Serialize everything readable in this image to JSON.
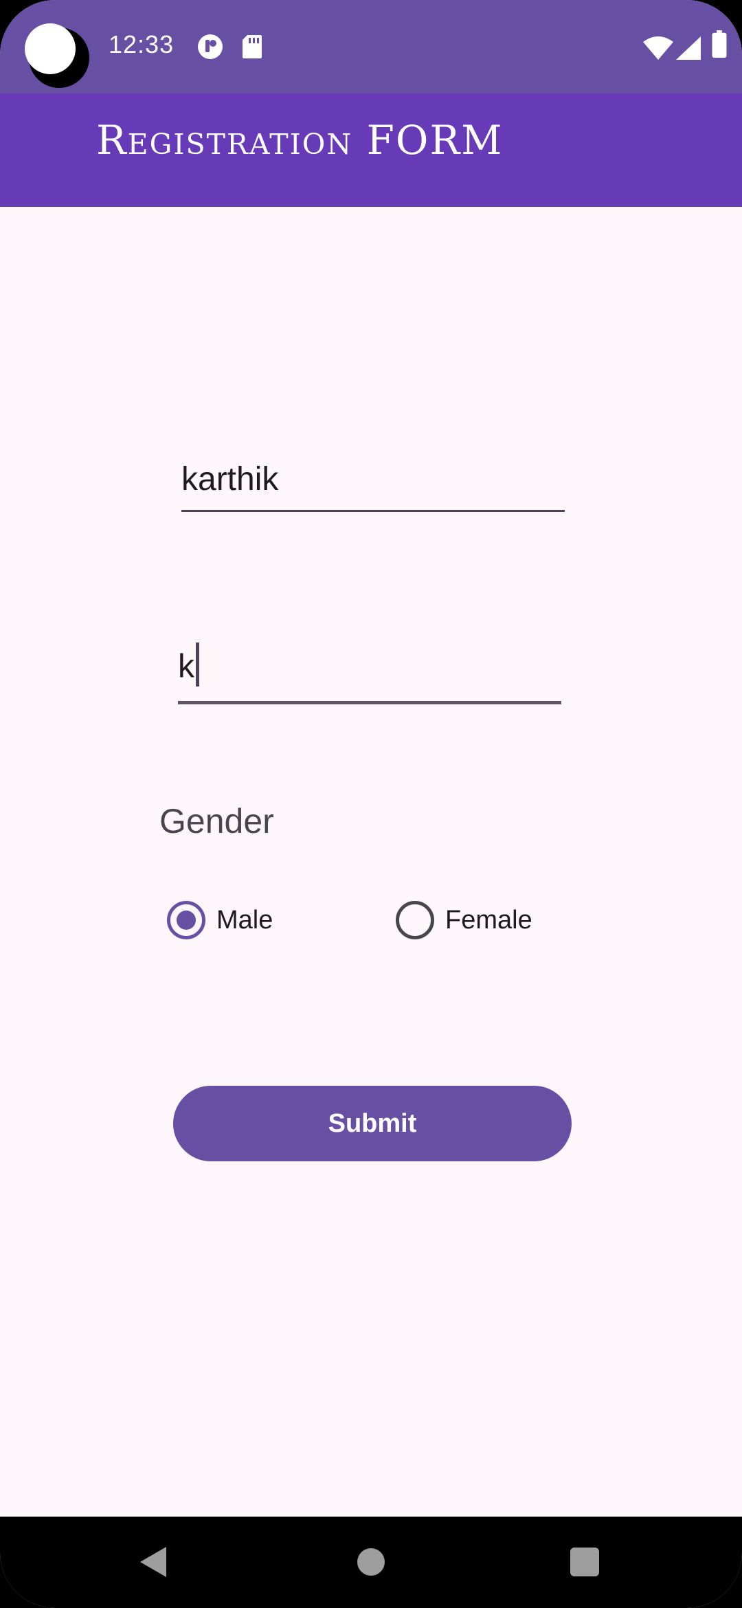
{
  "status_bar": {
    "time": "12:33",
    "icons": [
      "camera-cutout",
      "notification-app-icon",
      "sd-card-icon",
      "wifi-icon",
      "signal-icon",
      "battery-icon"
    ]
  },
  "app_bar": {
    "title": "Registration FORM",
    "color": "#673ab7"
  },
  "form": {
    "name_field_value": "karthik",
    "second_field_value": "k",
    "gender_label": "Gender",
    "gender_options": [
      {
        "label": "Male",
        "selected": true
      },
      {
        "label": "Female",
        "selected": false
      }
    ],
    "submit_label": "Submit"
  },
  "colors": {
    "accent": "#6750a4",
    "background": "#fdf7fb"
  },
  "nav_bar": {
    "buttons": [
      "back-icon",
      "home-icon",
      "recents-icon"
    ]
  }
}
